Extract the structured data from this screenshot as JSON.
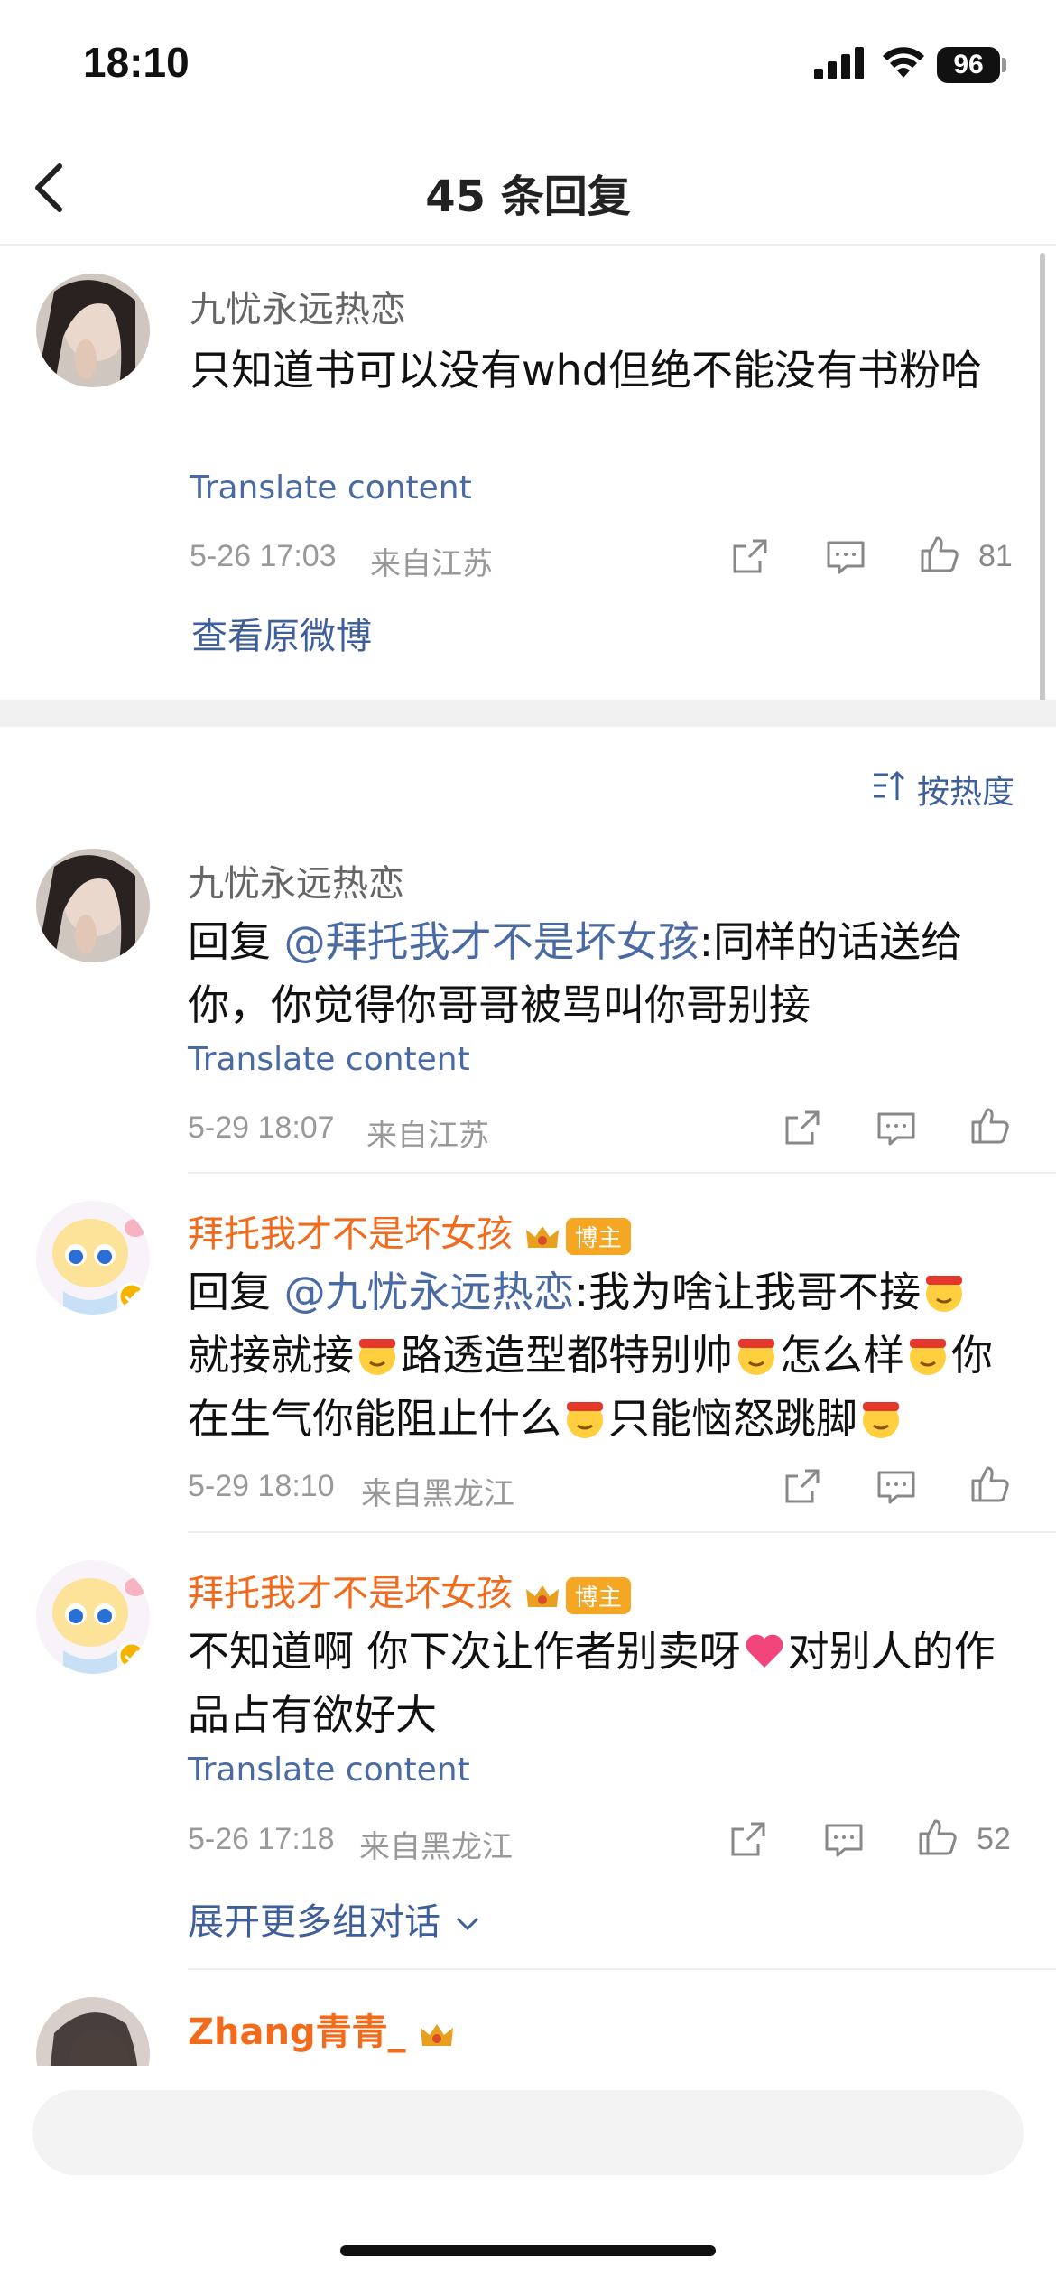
{
  "status_bar": {
    "time": "18:10",
    "battery": "96"
  },
  "nav": {
    "title": "45 条回复"
  },
  "original_comment": {
    "name": "九忧永远热恋",
    "text": "只知道书可以没有whd但绝不能没有书粉哈",
    "translate": "Translate content",
    "date": "5-26 17:03",
    "location": "来自江苏",
    "likes": "81",
    "view_link": "查看原微博"
  },
  "sort": {
    "label": "按热度"
  },
  "replies": [
    {
      "name": "九忧永远热恋",
      "prefix": "回复 ",
      "mention": "@拜托我才不是坏女孩",
      "text": ":同样的话送给你，你觉得你哥哥被骂叫你哥别接",
      "translate": "Translate content",
      "date": "5-29 18:07",
      "location": "来自江苏"
    },
    {
      "name": "拜托我才不是坏女孩",
      "badge": "博主",
      "prefix": "回复 ",
      "mention": "@九忧永远热恋",
      "segments": [
        ":我为啥让我哥不接",
        "就接就接",
        "路透造型都特别帅",
        "怎么样",
        "你在生气你能阻止什么",
        "只能恼怒跳脚"
      ],
      "date": "5-29 18:10",
      "location": "来自黑龙江"
    },
    {
      "name": "拜托我才不是坏女孩",
      "badge": "博主",
      "text_a": "不知道啊 你下次让作者别卖呀",
      "text_b": "对别人的作品占有欲好大",
      "translate": "Translate content",
      "date": "5-26 17:18",
      "location": "来自黑龙江",
      "likes": "52",
      "expand": "展开更多组对话"
    },
    {
      "name": "Zhang青青_"
    }
  ],
  "colors": {
    "vip_name": "#f26b1d",
    "link": "#4a6aa3",
    "meta": "#999999"
  },
  "icons": [
    "back-arrow-icon",
    "share-icon",
    "comment-icon",
    "like-icon",
    "sort-icon",
    "chevron-down-icon"
  ]
}
